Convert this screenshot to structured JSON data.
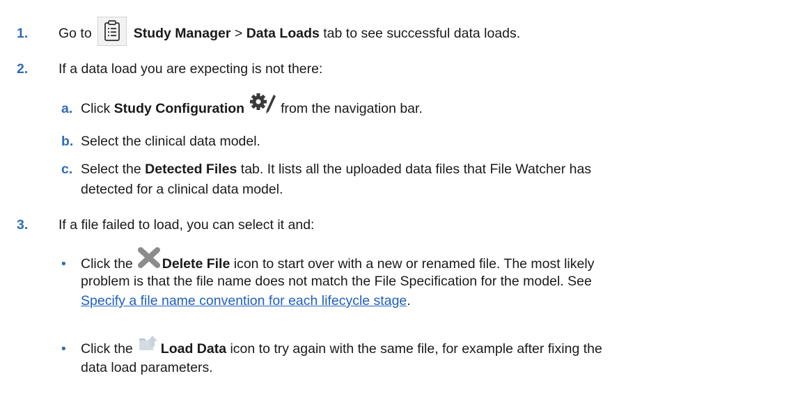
{
  "steps": [
    {
      "num": "1.",
      "pre": "Go to",
      "icon": "clipboard-icon",
      "bold1": "Study Manager",
      "sep": ">",
      "bold2": "Data Loads",
      "post": "tab to see successful data loads."
    },
    {
      "num": "2.",
      "text": "If a data load you are expecting is not there:",
      "substeps": [
        {
          "num": "a.",
          "pre": "Click",
          "bold": "Study Configuration",
          "icon": "gear-pencil-icon",
          "post": "from the navigation bar."
        },
        {
          "num": "b.",
          "text": "Select the clinical data model."
        },
        {
          "num": "c.",
          "pre": "Select the",
          "bold": "Detected Files",
          "post": "tab. It lists all the uploaded data files that File Watcher has",
          "line2": "detected for a clinical data model."
        }
      ]
    },
    {
      "num": "3.",
      "text": "If a file failed to load, you can select it and:",
      "bullets": [
        {
          "mark": "•",
          "pre": "Click the",
          "icon": "delete-x-icon",
          "bold": "Delete File",
          "post": "icon to start over with a new or renamed file. The most likely",
          "line2": "problem is that the file name does not match the File Specification for the model. See",
          "link": "Specify a file name convention for each lifecycle stage",
          "link_after": "."
        },
        {
          "mark": "•",
          "pre": "Click the",
          "icon": "load-data-folder-icon",
          "bold": "Load Data",
          "post": "icon to try again with the same file, for example after fixing the",
          "line2": "data load parameters."
        }
      ]
    }
  ],
  "colors": {
    "step_number": "#2f6cb5",
    "link": "#1f5fbf",
    "text": "#1a1a1a"
  }
}
